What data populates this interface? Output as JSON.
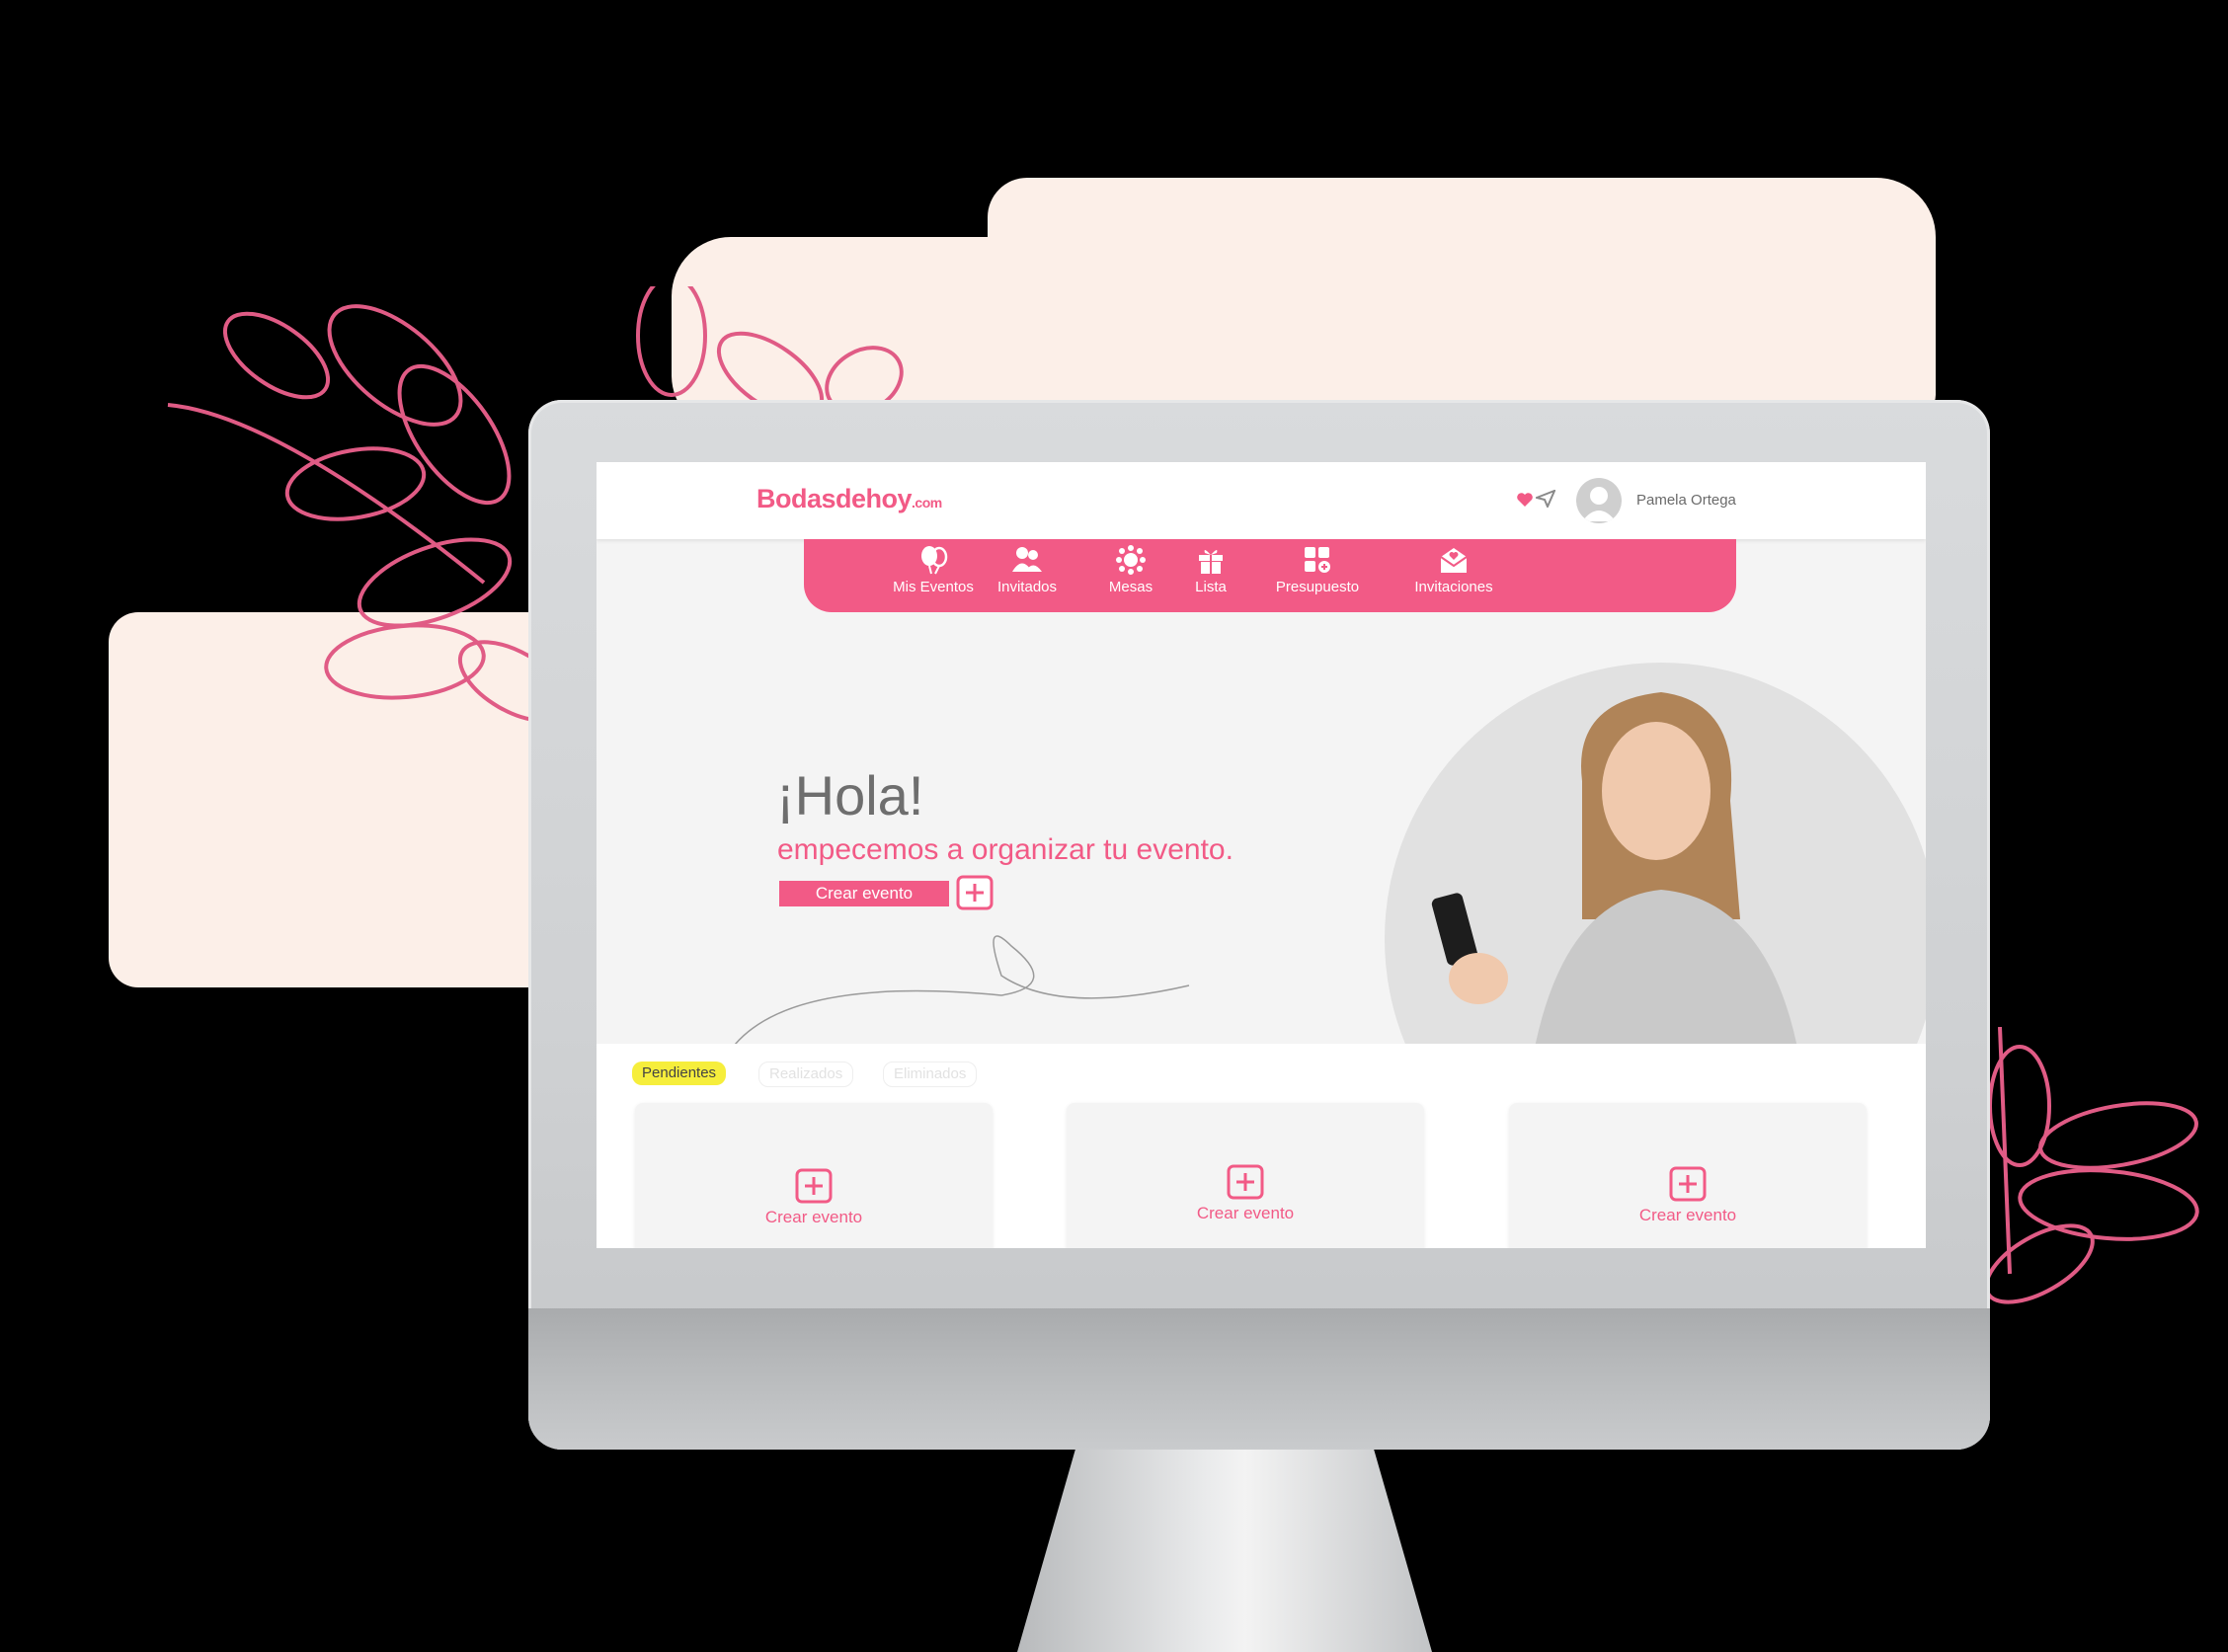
{
  "app": {
    "logo_main": "Bodasdehoy",
    "logo_suffix": ".com",
    "brand_color": "#f25a86"
  },
  "header": {
    "user_name": "Pamela Ortega",
    "icons": [
      "heart-icon",
      "send-icon",
      "avatar-icon"
    ]
  },
  "nav": {
    "items": [
      {
        "label": "Mis Eventos",
        "icon": "balloons-icon"
      },
      {
        "label": "Invitados",
        "icon": "people-icon"
      },
      {
        "label": "Mesas",
        "icon": "table-icon"
      },
      {
        "label": "Lista",
        "icon": "gift-icon"
      },
      {
        "label": "Presupuesto",
        "icon": "budget-icon"
      },
      {
        "label": "Invitaciones",
        "icon": "envelope-icon"
      }
    ]
  },
  "hero": {
    "greeting": "¡Hola!",
    "subtitle": "empecemos a organizar tu evento.",
    "button_label": "Crear evento"
  },
  "tabs": {
    "items": [
      {
        "label": "Pendientes",
        "active": true
      },
      {
        "label": "Realizados",
        "active": false
      },
      {
        "label": "Eliminados",
        "active": false
      }
    ],
    "highlight_color": "#f6ee3c"
  },
  "cards": [
    {
      "label": "Crear evento"
    },
    {
      "label": "Crear evento"
    },
    {
      "label": "Crear evento"
    }
  ]
}
